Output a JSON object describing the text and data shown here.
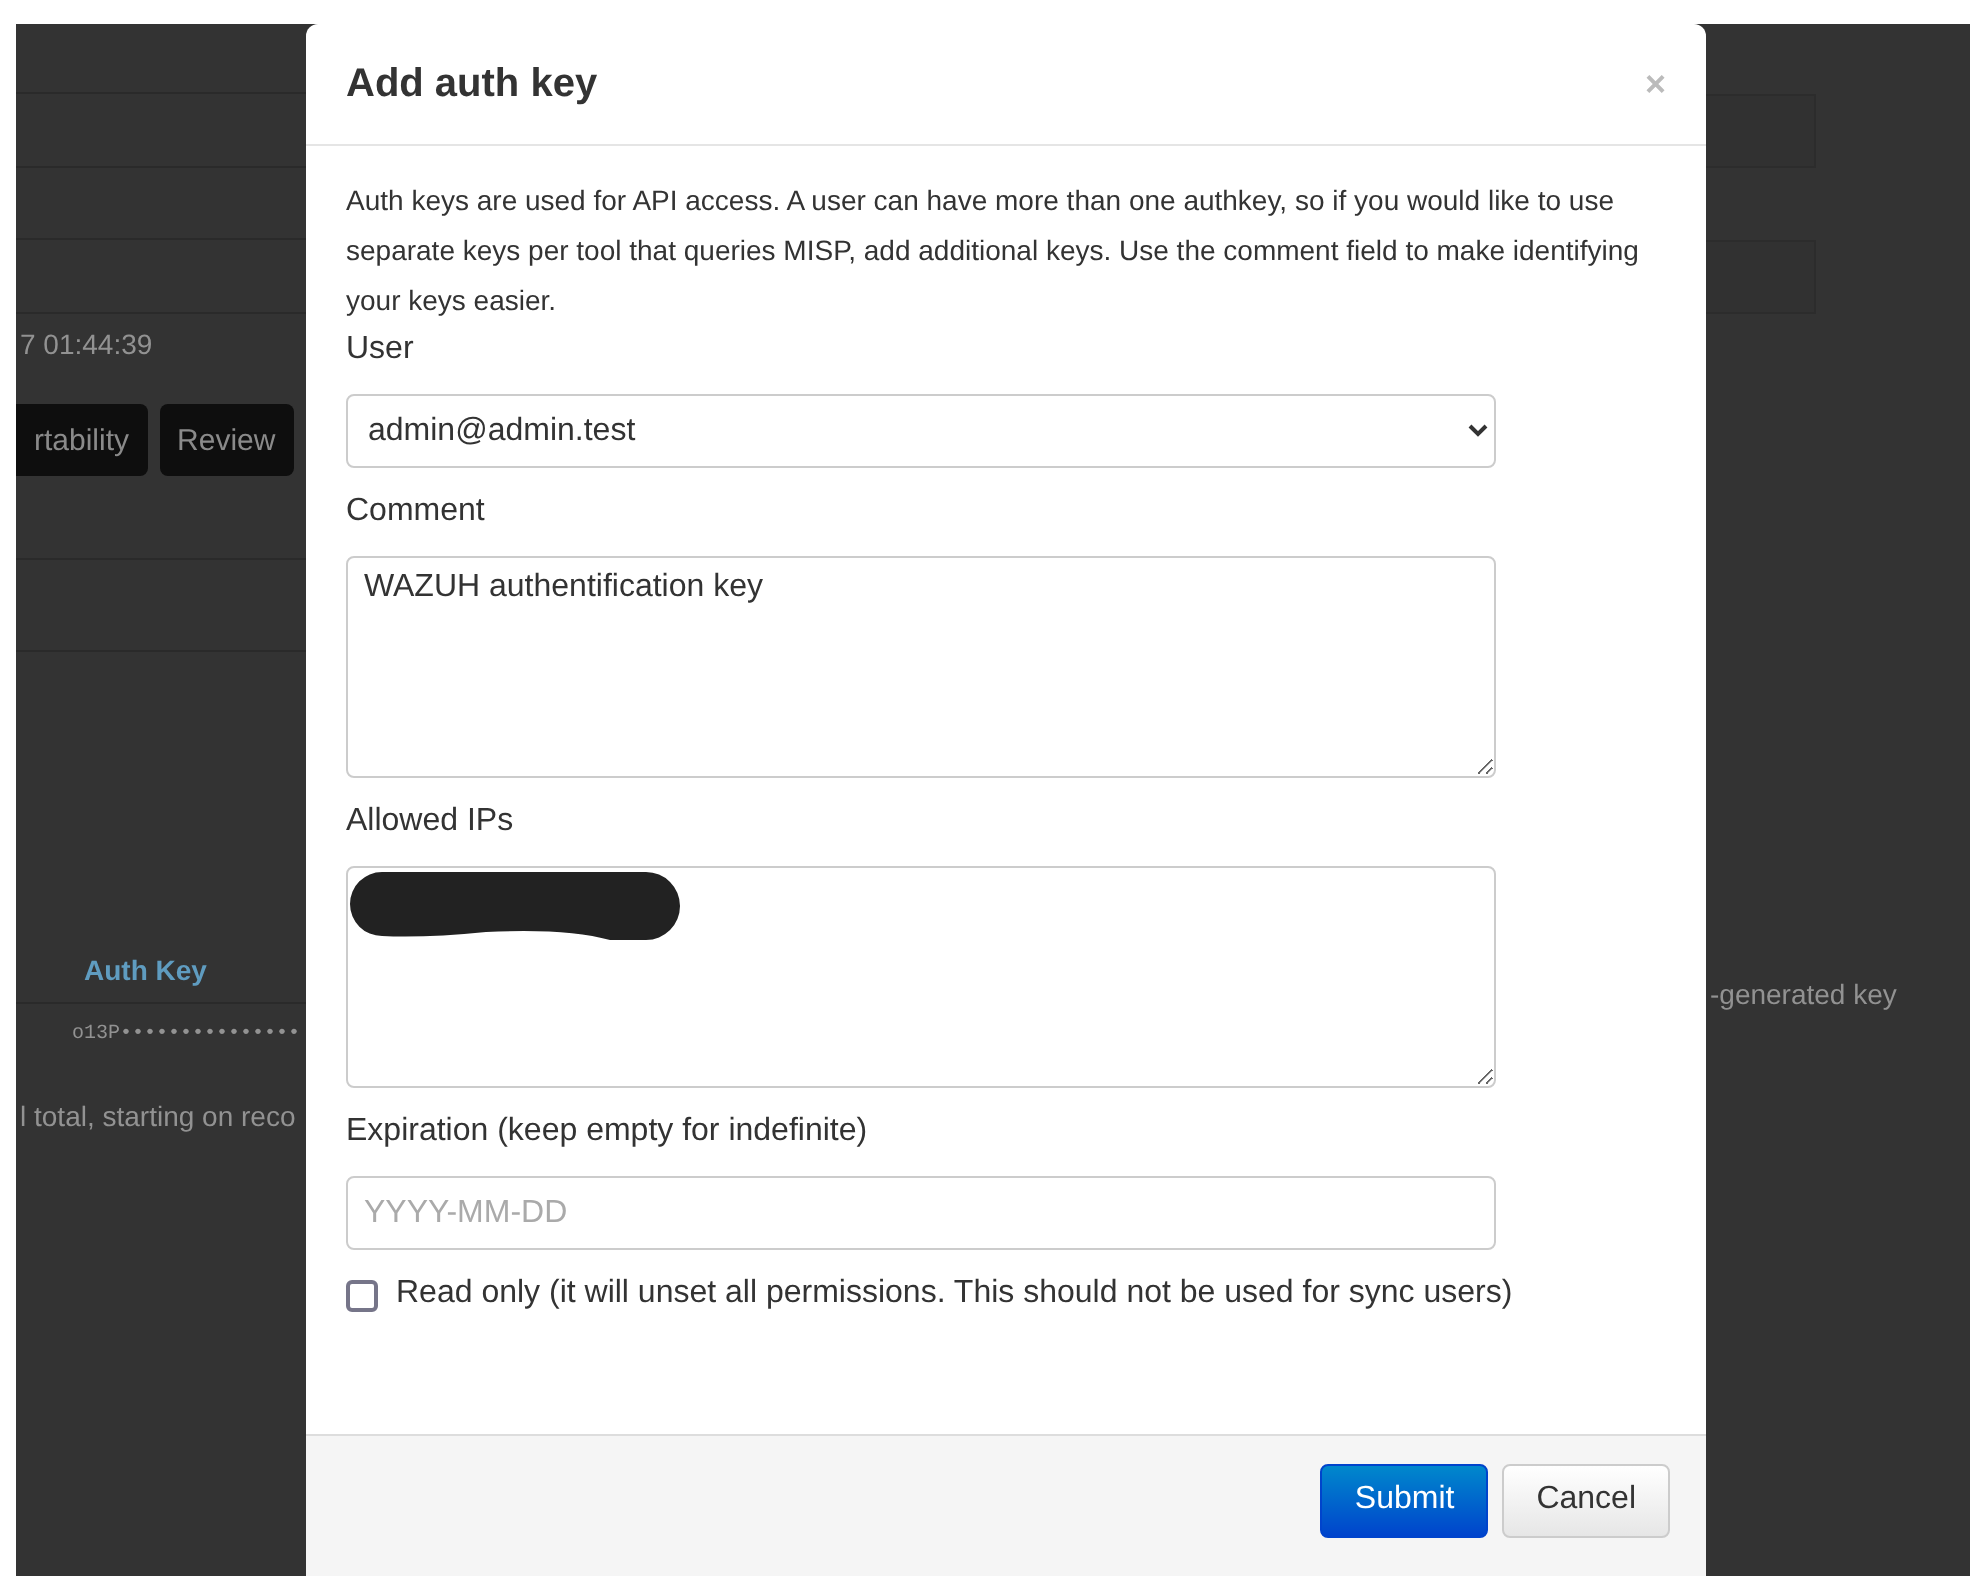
{
  "background": {
    "timestamp": "7 01:44:39",
    "buttons": [
      "rtability",
      "Review"
    ],
    "table_header": "Auth Key",
    "key_cell": "o13P•••••••••••••••",
    "comment_cell": "-generated key",
    "pagination": "l total, starting on reco"
  },
  "dialog": {
    "title": "Add auth key",
    "close": "×",
    "description": "Auth keys are used for API access. A user can have more than one authkey, so if you would like to use separate keys per tool that queries MISP, add additional keys. Use the comment field to make identifying your keys easier.",
    "fields": [
      {
        "kind": "select",
        "label": "User",
        "value": "admin@admin.test"
      },
      {
        "kind": "textarea",
        "label": "Comment",
        "value": "WAZUH authentification key"
      },
      {
        "kind": "textarea",
        "label": "Allowed IPs",
        "redacted": true
      },
      {
        "kind": "input",
        "label": "Expiration (keep empty for indefinite)",
        "placeholder": "YYYY-MM-DD"
      }
    ],
    "checkbox": {
      "label": "Read only (it will unset all permissions. This should not be used for sync users)",
      "checked": false
    },
    "buttons": [
      {
        "label": "Submit",
        "kind": "primary"
      },
      {
        "label": "Cancel",
        "kind": "default"
      }
    ]
  }
}
